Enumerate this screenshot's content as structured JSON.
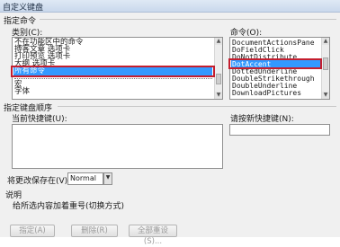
{
  "window": {
    "title": "自定义键盘"
  },
  "assign_command": {
    "section_title": "指定命令",
    "categories_label": "类别(C):",
    "categories": [
      "不在功能区中的命令",
      "搏客文章 选项卡",
      "打印预览 选项卡",
      "大纲 选项卡",
      "所有命令",
      "宏",
      "字体"
    ],
    "categories_selected": "所有命令",
    "commands_label": "命令(O):",
    "commands": [
      "DocumentActionsPane",
      "DoFieldClick",
      "DoNotDistribute",
      "DotAccent",
      "DottedUnderline",
      "DoubleStrikethrough",
      "DoubleUnderline",
      "DownloadPictures"
    ],
    "commands_selected": "DotAccent"
  },
  "keyboard_sequence": {
    "section_title": "指定键盘顺序",
    "current_keys_label": "当前快捷键(U):",
    "new_key_label": "请按新快捷键(N):",
    "save_in_label": "将更改保存在(V):",
    "save_in_value": "Normal"
  },
  "description": {
    "section_title": "说明",
    "text": "给所选内容加着重号(切换方式)"
  },
  "buttons": {
    "assign": "指定(A)",
    "remove": "删除(R)",
    "reset_all": "全部重设(S)..."
  }
}
